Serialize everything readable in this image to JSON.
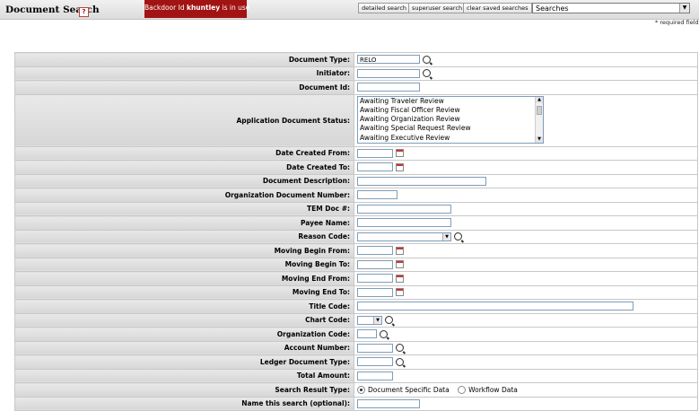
{
  "header": {
    "title": "Document Search",
    "help_icon": "help-icon",
    "backdoor_prefix": "Backdoor Id ",
    "backdoor_user": "khuntley",
    "backdoor_suffix": " is in use",
    "detailed_search": "detailed search",
    "superuser_search": "superuser search",
    "clear_saved_searches": "clear saved searches",
    "searches_select_value": "Searches",
    "required_note": "* required field"
  },
  "form": {
    "document_type": {
      "label": "Document Type:",
      "value": "RELO"
    },
    "initiator": {
      "label": "Initiator:",
      "value": ""
    },
    "document_id": {
      "label": "Document Id:",
      "value": ""
    },
    "app_doc_status": {
      "label": "Application Document Status:",
      "options": [
        "Awaiting Traveler Review",
        "Awaiting Fiscal Officer Review",
        "Awaiting Organization Review",
        "Awaiting Special Request Review",
        "Awaiting Executive Review"
      ]
    },
    "date_created_from": {
      "label": "Date Created From:",
      "value": ""
    },
    "date_created_to": {
      "label": "Date Created To:",
      "value": ""
    },
    "document_description": {
      "label": "Document Description:",
      "value": ""
    },
    "org_document_number": {
      "label": "Organization Document Number:",
      "value": ""
    },
    "tem_doc": {
      "label": "TEM Doc #:",
      "value": ""
    },
    "payee_name": {
      "label": "Payee Name:",
      "value": ""
    },
    "reason_code": {
      "label": "Reason Code:",
      "value": ""
    },
    "moving_begin_from": {
      "label": "Moving Begin From:",
      "value": ""
    },
    "moving_begin_to": {
      "label": "Moving Begin To:",
      "value": ""
    },
    "moving_end_from": {
      "label": "Moving End From:",
      "value": ""
    },
    "moving_end_to": {
      "label": "Moving End To:",
      "value": ""
    },
    "title_code": {
      "label": "Title Code:",
      "value": ""
    },
    "chart_code": {
      "label": "Chart Code:",
      "value": ""
    },
    "organization_code": {
      "label": "Organization Code:",
      "value": ""
    },
    "account_number": {
      "label": "Account Number:",
      "value": ""
    },
    "ledger_document_type": {
      "label": "Ledger Document Type:",
      "value": ""
    },
    "total_amount": {
      "label": "Total Amount:",
      "value": ""
    },
    "search_result_type": {
      "label": "Search Result Type:",
      "option_doc_specific": "Document Specific Data",
      "option_workflow": "Workflow Data",
      "selected": "Document Specific Data"
    },
    "name_this_search": {
      "label": "Name this search (optional):",
      "value": ""
    }
  }
}
